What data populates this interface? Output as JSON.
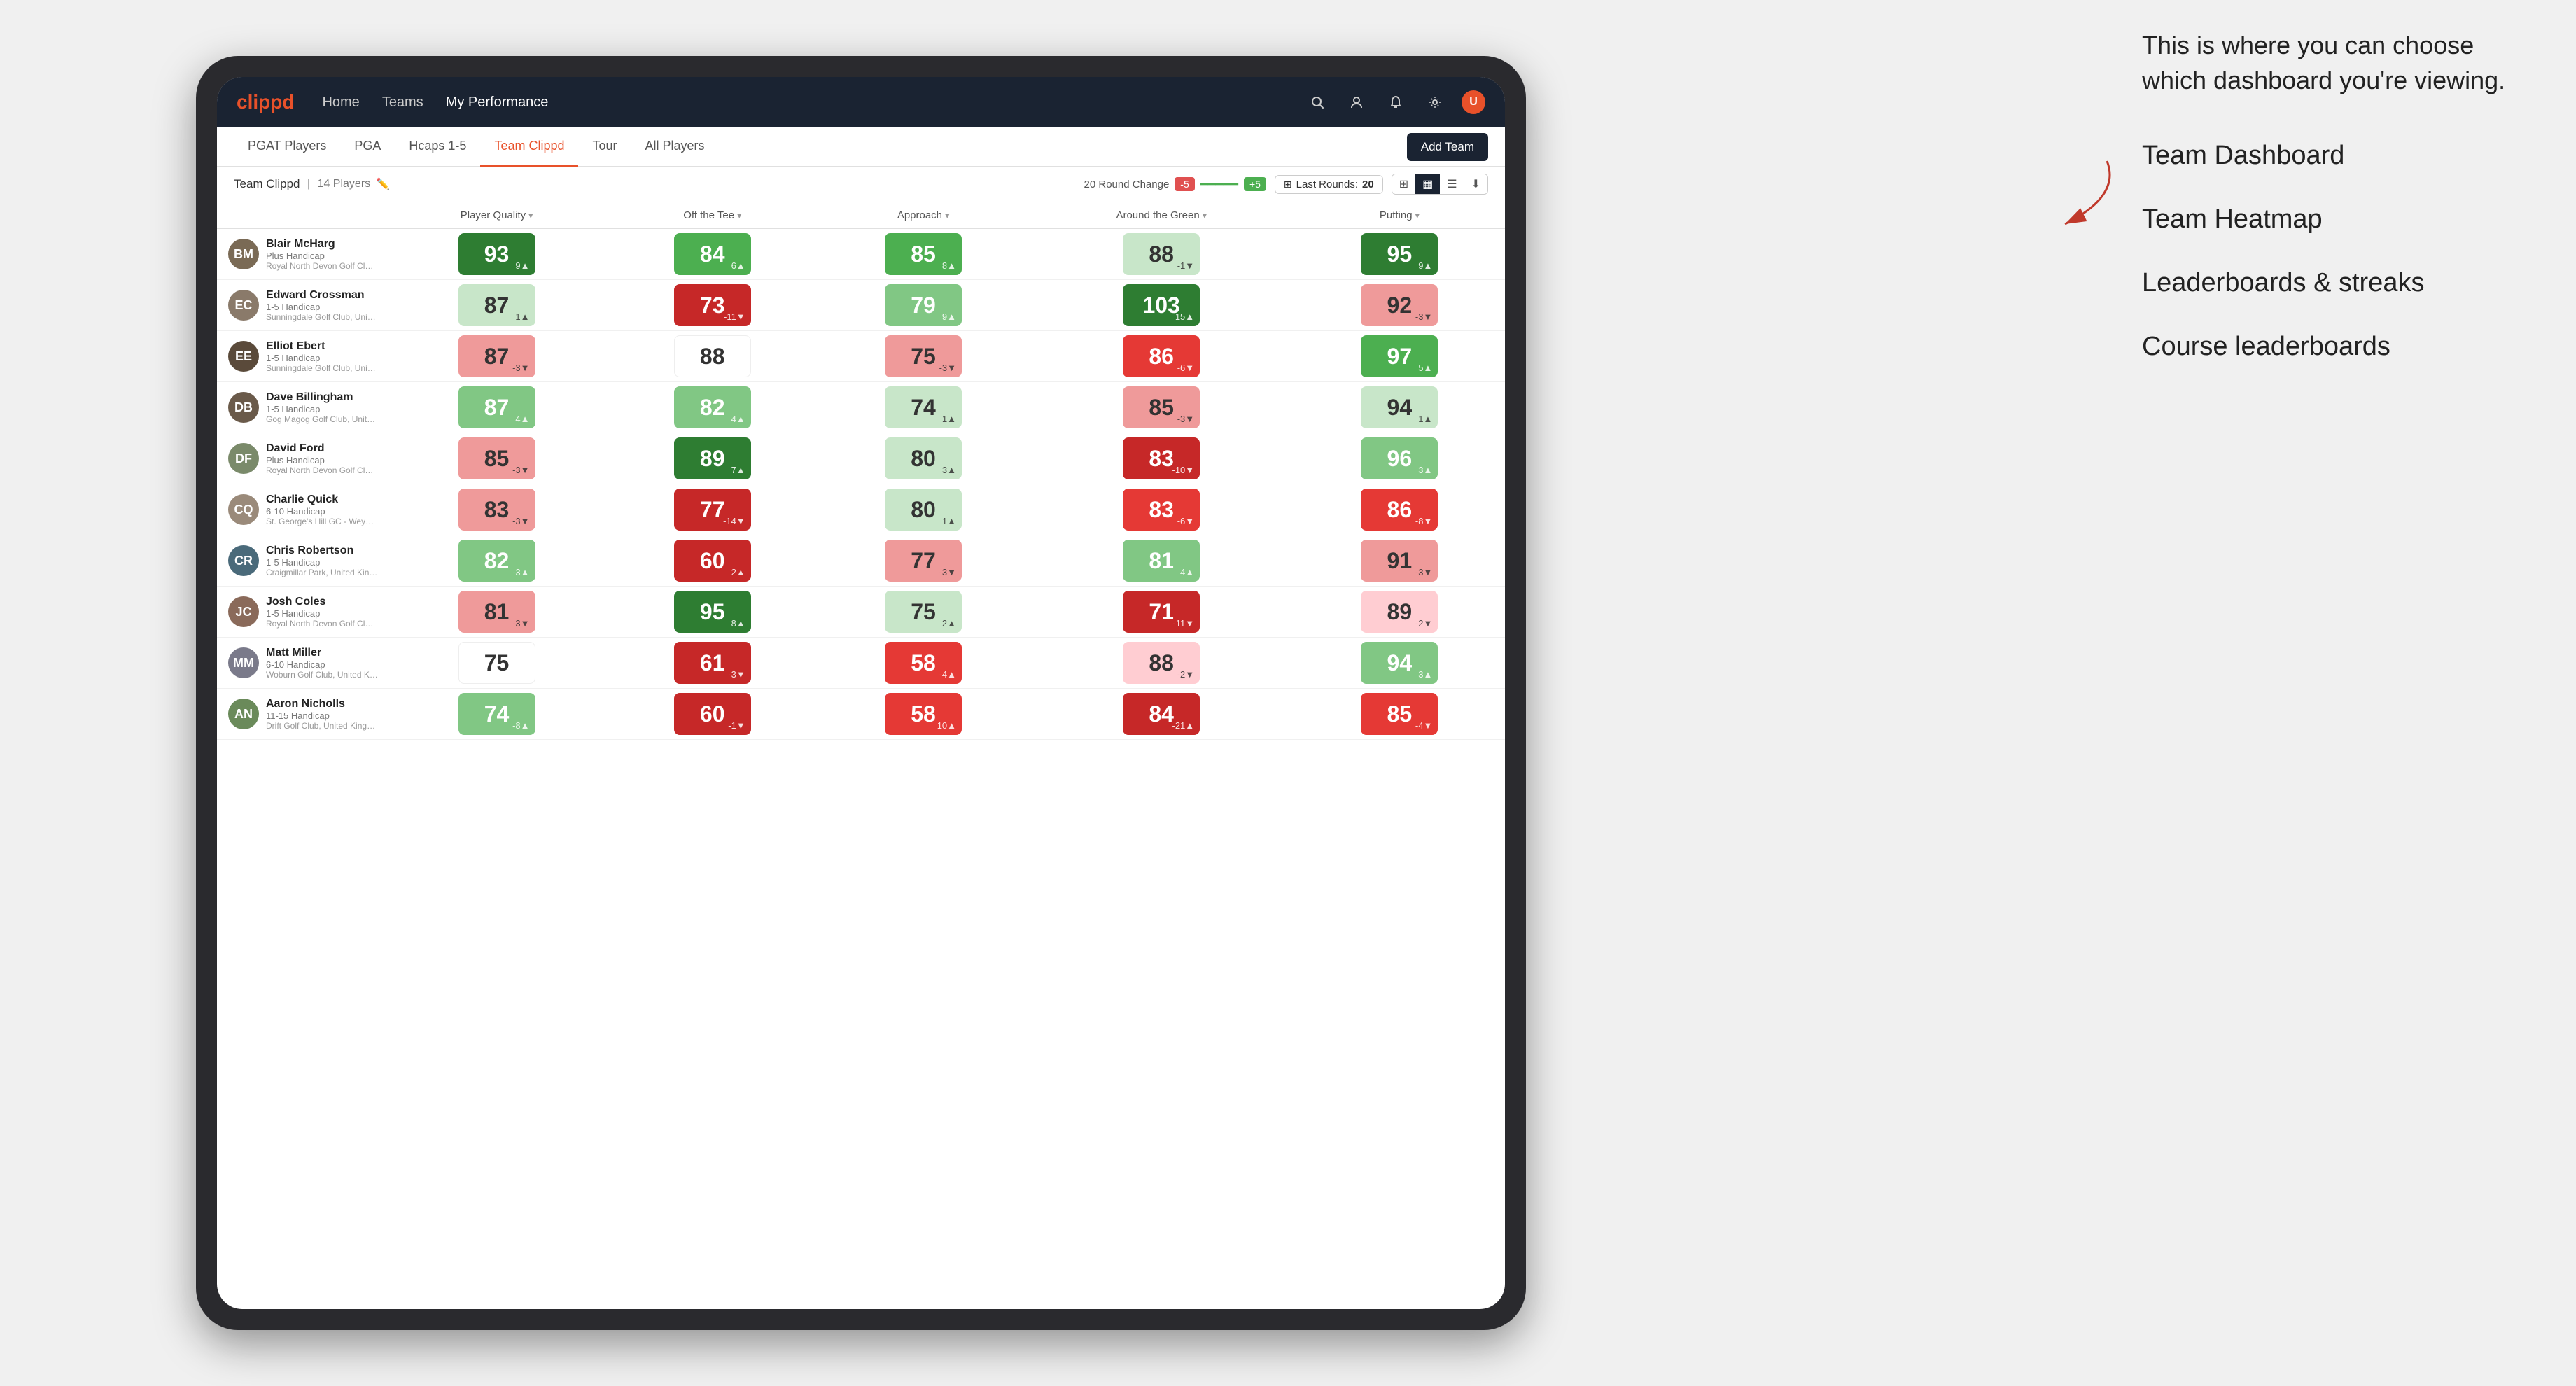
{
  "annotation": {
    "intro_text": "This is where you can choose which dashboard you're viewing.",
    "items": [
      "Team Dashboard",
      "Team Heatmap",
      "Leaderboards & streaks",
      "Course leaderboards"
    ]
  },
  "nav": {
    "logo": "clippd",
    "links": [
      "Home",
      "Teams",
      "My Performance"
    ],
    "active_link": "My Performance"
  },
  "secondary_nav": {
    "tabs": [
      "PGAT Players",
      "PGA",
      "Hcaps 1-5",
      "Team Clippd",
      "Tour",
      "All Players"
    ],
    "active_tab": "Team Clippd",
    "add_team_label": "Add Team"
  },
  "team_header": {
    "name": "Team Clippd",
    "separator": "|",
    "count_label": "14 Players",
    "round_change_label": "20 Round Change",
    "change_minus": "-5",
    "change_plus": "+5",
    "last_rounds_label": "Last Rounds:",
    "last_rounds_value": "20"
  },
  "table": {
    "columns": [
      {
        "label": "Player Quality",
        "sort": true
      },
      {
        "label": "Off the Tee",
        "sort": true
      },
      {
        "label": "Approach",
        "sort": true
      },
      {
        "label": "Around the Green",
        "sort": true
      },
      {
        "label": "Putting",
        "sort": true
      }
    ],
    "players": [
      {
        "name": "Blair McHarg",
        "handicap": "Plus Handicap",
        "club": "Royal North Devon Golf Club, United Kingdom",
        "avatar_color": "#7a6a55",
        "initials": "BM",
        "scores": [
          {
            "value": "93",
            "change": "9▲",
            "color": "green-dark"
          },
          {
            "value": "84",
            "change": "6▲",
            "color": "green-mid"
          },
          {
            "value": "85",
            "change": "8▲",
            "color": "green-mid"
          },
          {
            "value": "88",
            "change": "-1▼",
            "color": "green-pale"
          },
          {
            "value": "95",
            "change": "9▲",
            "color": "green-dark"
          }
        ]
      },
      {
        "name": "Edward Crossman",
        "handicap": "1-5 Handicap",
        "club": "Sunningdale Golf Club, United Kingdom",
        "avatar_color": "#8a7a6a",
        "initials": "EC",
        "scores": [
          {
            "value": "87",
            "change": "1▲",
            "color": "green-pale"
          },
          {
            "value": "73",
            "change": "-11▼",
            "color": "red-dark"
          },
          {
            "value": "79",
            "change": "9▲",
            "color": "green-light"
          },
          {
            "value": "103",
            "change": "15▲",
            "color": "green-dark"
          },
          {
            "value": "92",
            "change": "-3▼",
            "color": "red-light"
          }
        ]
      },
      {
        "name": "Elliot Ebert",
        "handicap": "1-5 Handicap",
        "club": "Sunningdale Golf Club, United Kingdom",
        "avatar_color": "#5a4a3a",
        "initials": "EE",
        "scores": [
          {
            "value": "87",
            "change": "-3▼",
            "color": "red-light"
          },
          {
            "value": "88",
            "change": "",
            "color": "neutral"
          },
          {
            "value": "75",
            "change": "-3▼",
            "color": "red-light"
          },
          {
            "value": "86",
            "change": "-6▼",
            "color": "red-mid"
          },
          {
            "value": "97",
            "change": "5▲",
            "color": "green-mid"
          }
        ]
      },
      {
        "name": "Dave Billingham",
        "handicap": "1-5 Handicap",
        "club": "Gog Magog Golf Club, United Kingdom",
        "avatar_color": "#6a5a4a",
        "initials": "DB",
        "scores": [
          {
            "value": "87",
            "change": "4▲",
            "color": "green-light"
          },
          {
            "value": "82",
            "change": "4▲",
            "color": "green-light"
          },
          {
            "value": "74",
            "change": "1▲",
            "color": "green-pale"
          },
          {
            "value": "85",
            "change": "-3▼",
            "color": "red-light"
          },
          {
            "value": "94",
            "change": "1▲",
            "color": "green-pale"
          }
        ]
      },
      {
        "name": "David Ford",
        "handicap": "Plus Handicap",
        "club": "Royal North Devon Golf Club, United Kingdom",
        "avatar_color": "#7a8a6a",
        "initials": "DF",
        "scores": [
          {
            "value": "85",
            "change": "-3▼",
            "color": "red-light"
          },
          {
            "value": "89",
            "change": "7▲",
            "color": "green-dark"
          },
          {
            "value": "80",
            "change": "3▲",
            "color": "green-pale"
          },
          {
            "value": "83",
            "change": "-10▼",
            "color": "red-dark"
          },
          {
            "value": "96",
            "change": "3▲",
            "color": "green-light"
          }
        ]
      },
      {
        "name": "Charlie Quick",
        "handicap": "6-10 Handicap",
        "club": "St. George's Hill GC - Weybridge - Surrey, Uni...",
        "avatar_color": "#9a8a7a",
        "initials": "CQ",
        "scores": [
          {
            "value": "83",
            "change": "-3▼",
            "color": "red-light"
          },
          {
            "value": "77",
            "change": "-14▼",
            "color": "red-dark"
          },
          {
            "value": "80",
            "change": "1▲",
            "color": "green-pale"
          },
          {
            "value": "83",
            "change": "-6▼",
            "color": "red-mid"
          },
          {
            "value": "86",
            "change": "-8▼",
            "color": "red-mid"
          }
        ]
      },
      {
        "name": "Chris Robertson",
        "handicap": "1-5 Handicap",
        "club": "Craigmillar Park, United Kingdom",
        "avatar_color": "#4a6a7a",
        "initials": "CR",
        "scores": [
          {
            "value": "82",
            "change": "-3▲",
            "color": "green-light"
          },
          {
            "value": "60",
            "change": "2▲",
            "color": "red-dark"
          },
          {
            "value": "77",
            "change": "-3▼",
            "color": "red-light"
          },
          {
            "value": "81",
            "change": "4▲",
            "color": "green-light"
          },
          {
            "value": "91",
            "change": "-3▼",
            "color": "red-light"
          }
        ]
      },
      {
        "name": "Josh Coles",
        "handicap": "1-5 Handicap",
        "club": "Royal North Devon Golf Club, United Kingdom",
        "avatar_color": "#8a6a5a",
        "initials": "JC",
        "scores": [
          {
            "value": "81",
            "change": "-3▼",
            "color": "red-light"
          },
          {
            "value": "95",
            "change": "8▲",
            "color": "green-dark"
          },
          {
            "value": "75",
            "change": "2▲",
            "color": "green-pale"
          },
          {
            "value": "71",
            "change": "-11▼",
            "color": "red-dark"
          },
          {
            "value": "89",
            "change": "-2▼",
            "color": "red-pale"
          }
        ]
      },
      {
        "name": "Matt Miller",
        "handicap": "6-10 Handicap",
        "club": "Woburn Golf Club, United Kingdom",
        "avatar_color": "#7a7a8a",
        "initials": "MM",
        "scores": [
          {
            "value": "75",
            "change": "",
            "color": "neutral"
          },
          {
            "value": "61",
            "change": "-3▼",
            "color": "red-dark"
          },
          {
            "value": "58",
            "change": "-4▲",
            "color": "red-mid"
          },
          {
            "value": "88",
            "change": "-2▼",
            "color": "red-pale"
          },
          {
            "value": "94",
            "change": "3▲",
            "color": "green-light"
          }
        ]
      },
      {
        "name": "Aaron Nicholls",
        "handicap": "11-15 Handicap",
        "club": "Drift Golf Club, United Kingdom",
        "avatar_color": "#6a8a5a",
        "initials": "AN",
        "scores": [
          {
            "value": "74",
            "change": "-8▲",
            "color": "green-light"
          },
          {
            "value": "60",
            "change": "-1▼",
            "color": "red-dark"
          },
          {
            "value": "58",
            "change": "10▲",
            "color": "red-mid"
          },
          {
            "value": "84",
            "change": "-21▲",
            "color": "red-dark"
          },
          {
            "value": "85",
            "change": "-4▼",
            "color": "red-mid"
          }
        ]
      }
    ]
  }
}
